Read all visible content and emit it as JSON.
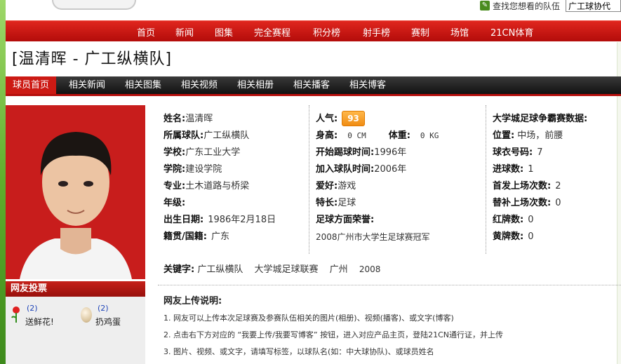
{
  "header": {
    "search_label": "查找您想看的队伍",
    "search_value": "广工球协代"
  },
  "nav": {
    "items": [
      "首页",
      "新闻",
      "图集",
      "完全赛程",
      "积分榜",
      "射手榜",
      "赛制",
      "场馆",
      "21CN体育"
    ]
  },
  "page": {
    "title": "[温清晖 - 广工纵横队]"
  },
  "subnav": {
    "items": [
      "球员首页",
      "相关新闻",
      "相关图集",
      "相关视频",
      "相关相册",
      "相关播客",
      "相关博客"
    ]
  },
  "vote": {
    "title": "网友投票",
    "flower_count": "(2)",
    "flower_label": "送鲜花!",
    "egg_count": "(2)",
    "egg_label": "扔鸡蛋"
  },
  "profile": {
    "name_label": "姓名:",
    "name": "温清晖",
    "team_label": "所属球队:",
    "team": "广工纵横队",
    "school_label": "学校:",
    "school": "广东工业大学",
    "college_label": "学院:",
    "college": "建设学院",
    "major_label": "专业:",
    "major": "土木道路与桥梁",
    "grade_label": "年级:",
    "grade": "",
    "birth_label": "出生日期:",
    "birth": "1986年2月18日",
    "origin_label": "籍贯/国籍:",
    "origin": "广东"
  },
  "stats": {
    "popularity_label": "人气:",
    "popularity": "93",
    "height_label": "身高:",
    "height": "0 CM",
    "weight_label": "体重:",
    "weight": "0 KG",
    "start_label": "开始踢球时间:",
    "start": "1996年",
    "join_label": "加入球队时间:",
    "join": "2006年",
    "hobby_label": "爱好:",
    "hobby": "游戏",
    "specialty_label": "特长:",
    "specialty": "足球",
    "honor_label": "足球方面荣誉:",
    "honor": "2008广州市大学生足球赛冠军"
  },
  "league": {
    "title": "大学城足球争霸赛数据:",
    "position_label": "位置:",
    "position": "中场，前腰",
    "number_label": "球衣号码:",
    "number": "7",
    "goals_label": "进球数:",
    "goals": "1",
    "starts_label": "首发上场次数:",
    "starts": "2",
    "subs_label": "替补上场次数:",
    "subs": "0",
    "red_label": "红牌数:",
    "red": "0",
    "yellow_label": "黄牌数:",
    "yellow": "0"
  },
  "keywords": {
    "label": "关键字:",
    "items": [
      "广工纵横队",
      "大学城足球联赛",
      "广州",
      "2008"
    ]
  },
  "upload": {
    "title": "网友上传说明:",
    "lines": [
      "1. 网友可以上传本次足球赛及参赛队伍相关的图片(相册)、视频(播客)、或文字(博客)",
      "2. 点击右下方对应的 “我要上传/我要写博客” 按钮，进入对应产品主页，登陆21CN通行证，并上传",
      "3. 图片、视频、或文字，请填写标签，以球队名(如：中大球协队)、或球员姓名"
    ]
  }
}
